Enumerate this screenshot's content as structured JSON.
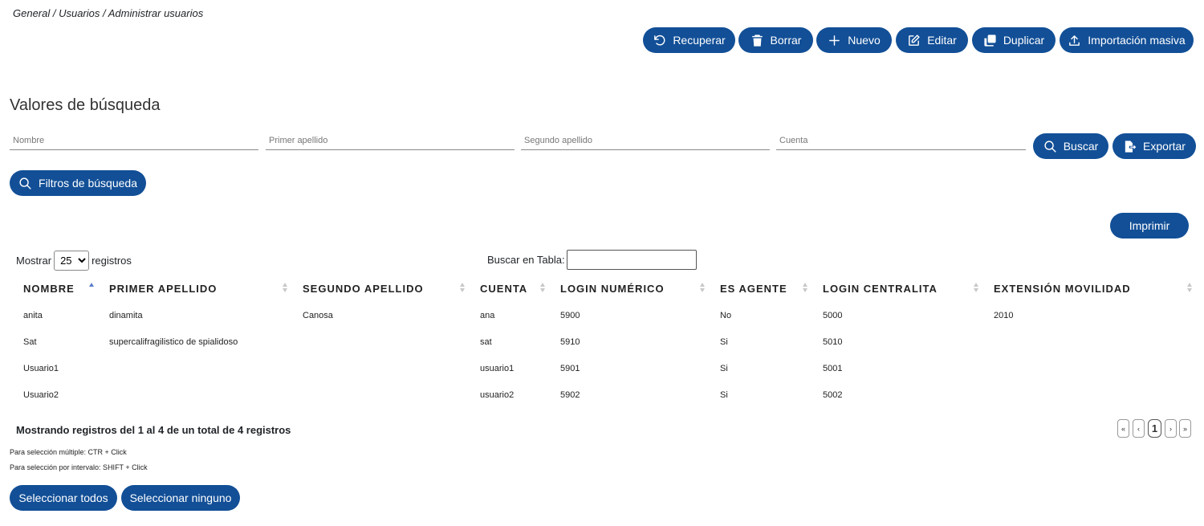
{
  "breadcrumb": "General / Usuarios / Administrar usuarios",
  "toolbar": {
    "recuperar": "Recuperar",
    "borrar": "Borrar",
    "nuevo": "Nuevo",
    "editar": "Editar",
    "duplicar": "Duplicar",
    "importacion": "Importación masiva"
  },
  "search": {
    "title": "Valores de búsqueda",
    "nombre_placeholder": "Nombre",
    "apellido1_placeholder": "Primer apellido",
    "apellido2_placeholder": "Segundo apellido",
    "cuenta_placeholder": "Cuenta",
    "buscar": "Buscar",
    "exportar": "Exportar",
    "filtros": "Filtros de búsqueda"
  },
  "print_label": "Imprimir",
  "table_controls": {
    "show_label": "Mostrar",
    "show_value": "25",
    "records_label": "registros",
    "search_label": "Buscar en Tabla:"
  },
  "table": {
    "columns": [
      "NOMBRE",
      "PRIMER APELLIDO",
      "SEGUNDO APELLIDO",
      "CUENTA",
      "LOGIN NUMÉRICO",
      "ES AGENTE",
      "LOGIN CENTRALITA",
      "EXTENSIÓN MOVILIDAD"
    ],
    "rows": [
      [
        "anita",
        "dinamita",
        "Canosa",
        "ana",
        "5900",
        "No",
        "5000",
        "2010"
      ],
      [
        "Sat",
        "supercalifragilistico de spialidoso",
        "",
        "sat",
        "5910",
        "Si",
        "5010",
        ""
      ],
      [
        "Usuario1",
        "",
        "",
        "usuario1",
        "5901",
        "Si",
        "5001",
        ""
      ],
      [
        "Usuario2",
        "",
        "",
        "usuario2",
        "5902",
        "Si",
        "5002",
        ""
      ]
    ]
  },
  "summary": "Mostrando registros del 1 al 4 de un total de 4 registros",
  "pagination": {
    "first": "«",
    "prev": "‹",
    "current": "1",
    "next": "›",
    "last": "»"
  },
  "hints": {
    "multiple": "Para selección múltiple: CTR + Click",
    "interval": "Para selección por intervalo: SHIFT + Click"
  },
  "selection": {
    "all": "Seleccionar todos",
    "none": "Seleccionar ninguno"
  },
  "colors": {
    "primary": "#124f97"
  }
}
